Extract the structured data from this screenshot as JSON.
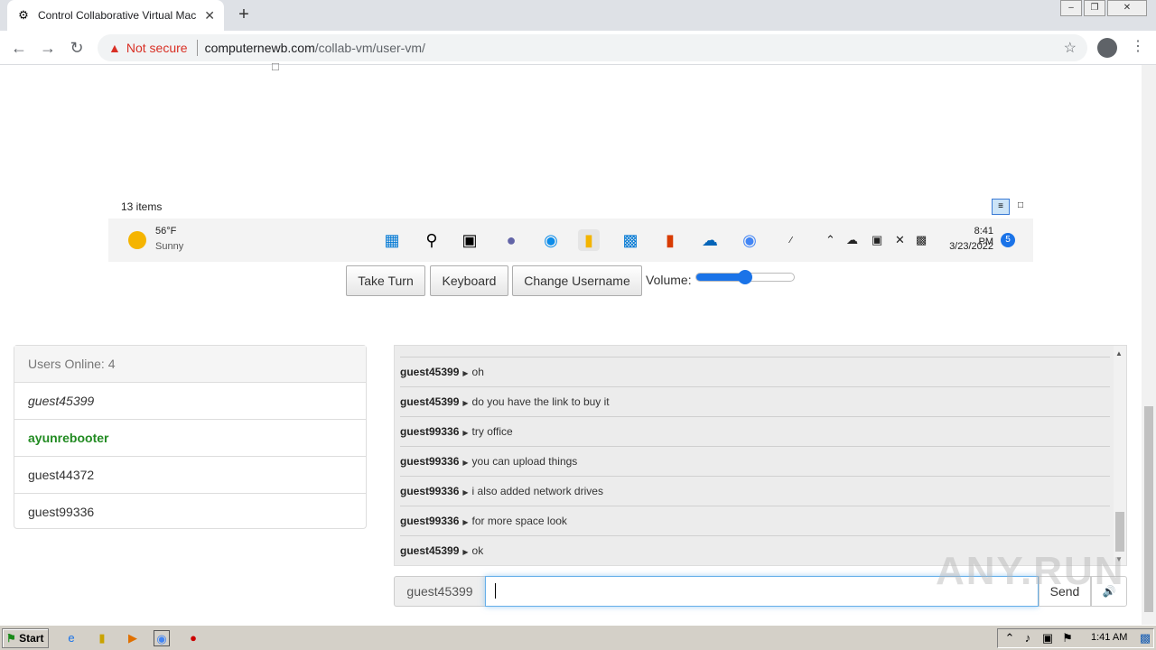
{
  "browser": {
    "tab_title": "Control Collaborative Virtual Machine",
    "not_secure_label": "Not secure",
    "url_host": "computernewb.com",
    "url_path": "/collab-vm/user-vm/"
  },
  "vm": {
    "items_count": "13 items",
    "weather": {
      "temp": "56°F",
      "desc": "Sunny"
    },
    "clock": {
      "time": "8:41 PM",
      "date": "3/23/2022"
    },
    "notification_count": "5"
  },
  "controls": {
    "take_turn": "Take Turn",
    "keyboard": "Keyboard",
    "change_username": "Change Username",
    "volume_label": "Volume:",
    "volume_level": 0.5
  },
  "users": {
    "header": "Users Online: 4",
    "list": [
      {
        "name": "guest45399"
      },
      {
        "name": "ayunrebooter"
      },
      {
        "name": "guest44372"
      },
      {
        "name": "guest99336"
      }
    ]
  },
  "chat": {
    "messages": [
      {
        "user": "guest45399",
        "text": "oh"
      },
      {
        "user": "guest45399",
        "text": "do you have the link to buy it"
      },
      {
        "user": "guest99336",
        "text": "try office"
      },
      {
        "user": "guest99336",
        "text": "you can upload things"
      },
      {
        "user": "guest99336",
        "text": "i also added network drives"
      },
      {
        "user": "guest99336",
        "text": "for more space look"
      },
      {
        "user": "guest45399",
        "text": "ok"
      }
    ],
    "username": "guest45399",
    "input_value": "",
    "send_label": "Send"
  },
  "watermark": "ANY.RUN",
  "host": {
    "start_label": "Start",
    "clock": "1:41 AM"
  }
}
